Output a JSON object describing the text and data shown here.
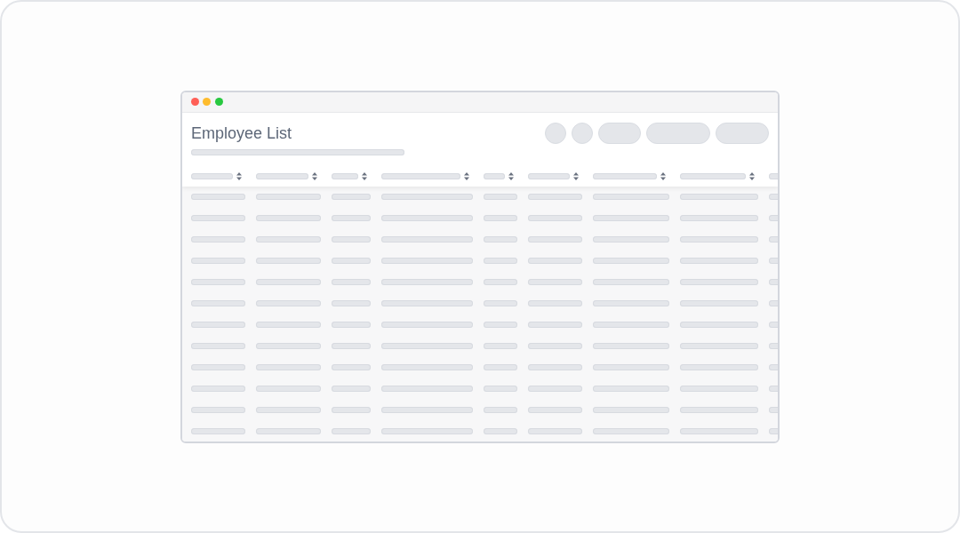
{
  "page": {
    "title": "Employee List",
    "loading": true
  }
}
